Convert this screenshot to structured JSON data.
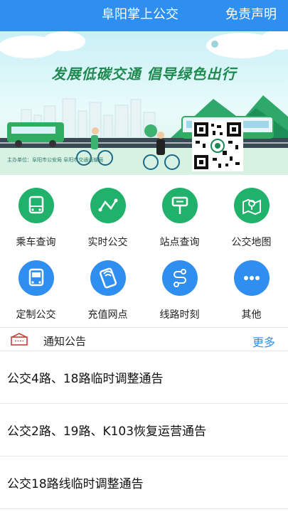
{
  "header": {
    "title": "阜阳掌上公交",
    "disclaimer": "免责声明"
  },
  "banner": {
    "slogan": "发展低碳交通 倡导绿色出行",
    "smallprint": "主办单位：阜阳市公安局 阜阳市交通运输局"
  },
  "features": [
    {
      "label": "乘车查询",
      "icon": "bus-icon",
      "color": "#20b26b"
    },
    {
      "label": "实时公交",
      "icon": "realtime-line-icon",
      "color": "#20b26b"
    },
    {
      "label": "站点查询",
      "icon": "bus-stop-sign-icon",
      "color": "#20b26b"
    },
    {
      "label": "公交地图",
      "icon": "map-pin-icon",
      "color": "#20b26b"
    },
    {
      "label": "定制公交",
      "icon": "bus-front-icon",
      "color": "#2e8ff0"
    },
    {
      "label": "充值网点",
      "icon": "card-recharge-icon",
      "color": "#2e8ff0"
    },
    {
      "label": "线路时刻",
      "icon": "route-schedule-icon",
      "color": "#2e8ff0"
    },
    {
      "label": "其他",
      "icon": "more-dots-icon",
      "color": "#2e8ff0"
    }
  ],
  "notice": {
    "title": "通知公告",
    "more": "更多"
  },
  "news": [
    "公交4路、18路临时调整通告",
    "公交2路、19路、K103恢复运营通告",
    "公交18路线临时调整通告"
  ]
}
